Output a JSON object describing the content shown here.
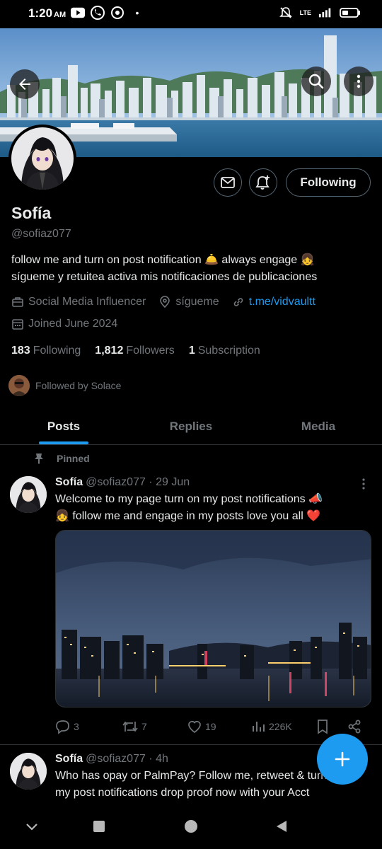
{
  "status_bar": {
    "time": "1:20",
    "ampm": "AM",
    "dot": "•",
    "network": "LTE"
  },
  "profile": {
    "display_name": "Sofía",
    "handle": "@sofiaz077",
    "bio_line1": "follow me and turn on post notification 🛎️ always engage 👧",
    "bio_line2": "sígueme y retuitea activa mis notificaciones de publicaciones",
    "category": "Social Media Influencer",
    "location": "sígueme",
    "link": "t.me/vidvaultt",
    "joined": "Joined June 2024",
    "following_btn": "Following"
  },
  "stats": {
    "following_count": "183",
    "following_label": "Following",
    "followers_count": "1,812",
    "followers_label": "Followers",
    "subscription_count": "1",
    "subscription_label": "Subscription"
  },
  "followed_by": "Followed by Solace",
  "tabs": [
    "Posts",
    "Replies",
    "Media"
  ],
  "posts": [
    {
      "pinned_label": "Pinned",
      "name": "Sofía",
      "meta": "@sofiaz077 · 29 Jun",
      "text_line1": "Welcome to my page  turn on my post notifications 📣",
      "text_line2": "👧 follow me and engage in my posts love you all ❤️",
      "replies": "3",
      "reposts": "7",
      "likes": "19",
      "views": "226K"
    },
    {
      "name": "Sofía",
      "meta": "@sofiaz077 · 4h",
      "text_line1": "Who has opay or PalmPay? Follow me, retweet & turn on",
      "text_line2": "my post notifications drop proof now with your Acct"
    }
  ],
  "colors": {
    "accent": "#1d9bf0",
    "muted": "#71767b",
    "text": "#e7e9ea",
    "background": "#000000",
    "border": "#2f3336"
  }
}
